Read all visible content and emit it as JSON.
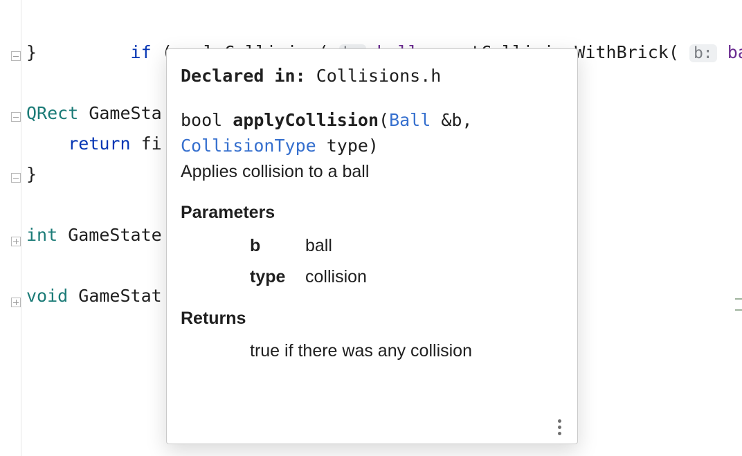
{
  "code": {
    "line1": {
      "kw_if": "if",
      "open": " (",
      "fn1": "applyCollision",
      "paren1": "(",
      "hint1": "b:",
      "arg1": "ball_",
      "comma1": ", ",
      "fn2": "getCollisionWithBrick",
      "paren2": "(",
      "hint2": "b:",
      "arg2": "ball_",
      "tail": ","
    },
    "line2": "}",
    "line4_type": "QRect",
    "line4_rest": " GameSta",
    "line5_kw": "return",
    "line5_rest": " fi",
    "line6": "}",
    "line8_type": "int",
    "line8_rest": " GameState",
    "line10_type": "void",
    "line10_rest": " GameStat"
  },
  "doc": {
    "declared_label": "Declared in:",
    "declared_value": "Collisions.h",
    "sig_ret": "bool",
    "sig_name": "applyCollision",
    "sig_open": "(",
    "sig_p1_type": "Ball",
    "sig_p1_rest": " &b,",
    "sig_p2_type": "CollisionType",
    "sig_p2_rest": " type)",
    "brief": "Applies collision to a ball",
    "params_heading": "Parameters",
    "params": [
      {
        "name": "b",
        "desc": "ball"
      },
      {
        "name": "type",
        "desc": "collision"
      }
    ],
    "returns_heading": "Returns",
    "returns_desc": "true if there was any collision"
  }
}
